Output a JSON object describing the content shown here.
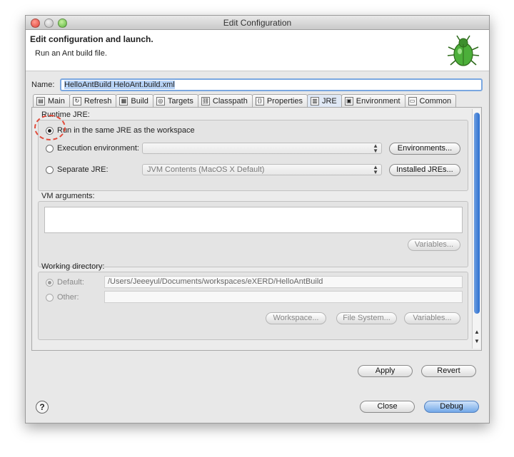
{
  "window": {
    "title": "Edit Configuration"
  },
  "header": {
    "title": "Edit configuration and launch.",
    "subtitle": "Run an Ant build file."
  },
  "name": {
    "label": "Name:",
    "value": "HelloAntBuild HeloAnt.build.xml"
  },
  "tabs": [
    {
      "label": "Main",
      "icon": "main-tab-icon"
    },
    {
      "label": "Refresh",
      "icon": "refresh-icon"
    },
    {
      "label": "Build",
      "icon": "build-icon"
    },
    {
      "label": "Targets",
      "icon": "targets-icon"
    },
    {
      "label": "Classpath",
      "icon": "classpath-icon"
    },
    {
      "label": "Properties",
      "icon": "properties-icon"
    },
    {
      "label": "JRE",
      "icon": "jre-icon",
      "active": true
    },
    {
      "label": "Environment",
      "icon": "environment-icon"
    },
    {
      "label": "Common",
      "icon": "common-icon"
    }
  ],
  "jre": {
    "group_label": "Runtime JRE:",
    "same_jre": "Run in the same JRE as the workspace",
    "exec_env": "Execution environment:",
    "exec_env_value": "",
    "environments_btn": "Environments...",
    "separate_jre": "Separate JRE:",
    "separate_jre_value": "JVM Contents (MacOS X Default)",
    "installed_jres_btn": "Installed JREs..."
  },
  "vm": {
    "label": "VM arguments:",
    "value": "",
    "variables_btn": "Variables..."
  },
  "workdir": {
    "label": "Working directory:",
    "default_label": "Default:",
    "default_value": "/Users/Jeeeyul/Documents/workspaces/eXERD/HelloAntBuild",
    "other_label": "Other:",
    "other_value": "",
    "workspace_btn": "Workspace...",
    "filesystem_btn": "File System...",
    "variables_btn": "Variables..."
  },
  "actions": {
    "apply": "Apply",
    "revert": "Revert",
    "close": "Close",
    "debug": "Debug",
    "help": "?"
  },
  "colors": {
    "accent": "#73a8e8",
    "highlight_circle": "#e04a3a",
    "selection": "#b7d2f5"
  }
}
